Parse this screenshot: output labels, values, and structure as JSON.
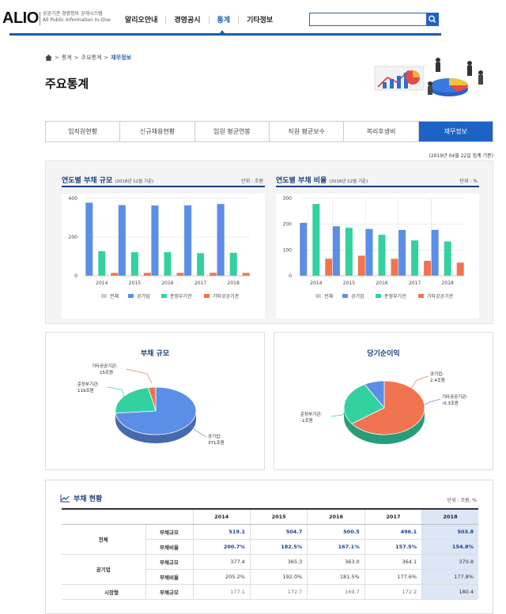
{
  "header": {
    "logo": "ALIO",
    "logo_sub_1": "공공기관 경영정보 공개시스템",
    "logo_sub_2": "All Public Information In-One",
    "nav": [
      "알리오안내",
      "경영공시",
      "통계",
      "기타정보"
    ],
    "nav_active": 2,
    "search_placeholder": ""
  },
  "breadcrumb": {
    "items": [
      "통계",
      "주요통계",
      "재무정보"
    ]
  },
  "page_title": "주요통계",
  "tabs": {
    "items": [
      "임직원현황",
      "신규채용현황",
      "임원 평균연봉",
      "직원 평균보수",
      "복리후생비",
      "재무정보"
    ],
    "active": 5
  },
  "date_note": "(2019년 04월 22일 집계 기준)",
  "charts": {
    "left": {
      "title": "연도별 부채 규모",
      "basis": "(2018년 12월 기준)",
      "unit": "단위 : 조원"
    },
    "right": {
      "title": "연도별 부채 비율",
      "basis": "(2018년 12월 기준)",
      "unit": "단위 : %"
    }
  },
  "legend": [
    "전체",
    "공기업",
    "준정부기관",
    "기타공공기관"
  ],
  "chart_data": [
    {
      "type": "bar",
      "title": "연도별 부채 규모",
      "categories": [
        "2014",
        "2015",
        "2016",
        "2017",
        "2018"
      ],
      "ylim": [
        0,
        400
      ],
      "yticks": [
        0,
        200,
        400
      ],
      "series": [
        {
          "name": "전체",
          "values": [
            0,
            0,
            0,
            0,
            0
          ],
          "color": "#cccccc"
        },
        {
          "name": "공기업",
          "values": [
            377.4,
            365.3,
            363.0,
            364.1,
            370.8
          ],
          "color": "#5b8ee6"
        },
        {
          "name": "준정부기관",
          "values": [
            127,
            122,
            122,
            117,
            119
          ],
          "color": "#33d1a0"
        },
        {
          "name": "기타공공기관",
          "values": [
            15,
            15,
            15,
            15,
            15
          ],
          "color": "#f0744f"
        }
      ],
      "legend": "bottom",
      "grid": true
    },
    {
      "type": "bar",
      "title": "연도별 부채 비율",
      "categories": [
        "2014",
        "2015",
        "2016",
        "2017",
        "2018"
      ],
      "ylim": [
        0,
        300
      ],
      "yticks": [
        0,
        100,
        200,
        300
      ],
      "series": [
        {
          "name": "전체",
          "values": [
            0,
            0,
            0,
            0,
            0
          ],
          "color": "#cccccc"
        },
        {
          "name": "공기업",
          "values": [
            205.2,
            192.0,
            181.5,
            177.6,
            177.8
          ],
          "color": "#5b8ee6"
        },
        {
          "name": "준정부기관",
          "values": [
            278,
            186,
            159,
            137,
            133
          ],
          "color": "#33d1a0"
        },
        {
          "name": "기타공공기관",
          "values": [
            66,
            78,
            66,
            58,
            51
          ],
          "color": "#f0744f"
        }
      ],
      "legend": "bottom",
      "grid": true
    },
    {
      "type": "pie",
      "title": "부채 규모",
      "labels": [
        "공기업",
        "준정부기관",
        "기타공공기관"
      ],
      "values": [
        371,
        119,
        15
      ],
      "value_labels": [
        "371조원",
        "119조원",
        "15조원"
      ],
      "colors": [
        "#5b8ee6",
        "#33d1a0",
        "#f0744f"
      ]
    },
    {
      "type": "pie",
      "title": "당기순이익",
      "labels": [
        "공기업",
        "준정부기관",
        "기타공공기관"
      ],
      "values": [
        2.4,
        -1,
        -0.3
      ],
      "value_labels": [
        "2.4조원",
        "-1조원",
        "-0.3조원"
      ],
      "colors": [
        "#f0744f",
        "#33d1a0",
        "#5b8ee6"
      ]
    }
  ],
  "pie_labels": {
    "left": {
      "title": "부채 규모",
      "gong": [
        "공기업:",
        "371조원"
      ],
      "jun": [
        "준정부기관:",
        "119조원"
      ],
      "gita": [
        "기타공공기관:",
        "15조원"
      ]
    },
    "right": {
      "title": "당기순이익",
      "gong": [
        "공기업:",
        "2.4조원"
      ],
      "jun": [
        "준정부기관:",
        "-1조원"
      ],
      "gita": [
        "기타공공기관:",
        "-0.3조원"
      ]
    }
  },
  "table": {
    "title": "부채 현황",
    "unit": "단위 : 조원, %",
    "years": [
      "2014",
      "2015",
      "2016",
      "2017",
      "2018"
    ],
    "rows": [
      {
        "cat": "전체",
        "sub": "",
        "metric": "부채규모",
        "vals": [
          "519.1",
          "504.7",
          "500.5",
          "496.1",
          "503.8"
        ],
        "style": "blue"
      },
      {
        "cat": "",
        "sub": "",
        "metric": "부채비율",
        "vals": [
          "200.7%",
          "182.5%",
          "167.1%",
          "157.5%",
          "154.8%"
        ],
        "style": "blue"
      },
      {
        "cat": "공기업",
        "sub": "",
        "metric": "부채규모",
        "vals": [
          "377.4",
          "365.3",
          "363.0",
          "364.1",
          "370.8"
        ],
        "style": ""
      },
      {
        "cat": "",
        "sub": "",
        "metric": "부채비율",
        "vals": [
          "205.2%",
          "192.0%",
          "181.5%",
          "177.6%",
          "177.8%"
        ],
        "style": ""
      },
      {
        "cat": "",
        "sub": "시장형",
        "metric": "부채규모",
        "vals": [
          "177.1",
          "172.7",
          "169.7",
          "172.2",
          "180.4"
        ],
        "style": "grey"
      }
    ]
  }
}
